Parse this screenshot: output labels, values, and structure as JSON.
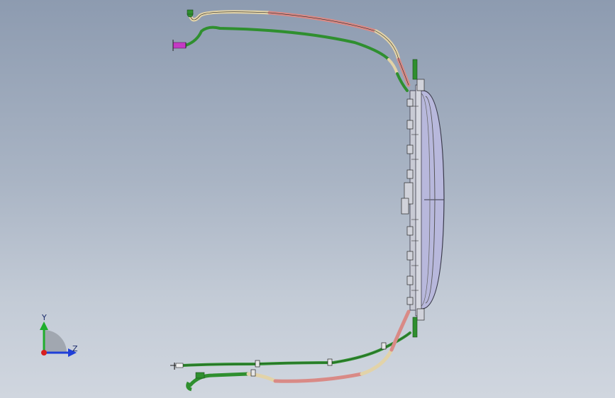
{
  "viewport": {
    "background_top": "#8d9bb0",
    "background_bottom": "#d0d6df"
  },
  "triad": {
    "y_label": "Y",
    "z_label": "Z",
    "y_color": "#1fae2c",
    "z_color": "#1f3fd8",
    "x_color": "#d81f1f"
  },
  "colors": {
    "hose_tan": "#e2d3a8",
    "hose_salmon": "#d98a86",
    "hose_green": "#2f8f2f",
    "connector_magenta": "#c43ac4",
    "radiator_fill": "#b8b8dc",
    "radiator_edge": "#3a3a4a"
  },
  "model": {
    "name": "radiator-fan-assembly",
    "icons": [
      "hose-fitting-icon",
      "radiator-core-icon",
      "clamp-icon"
    ]
  }
}
